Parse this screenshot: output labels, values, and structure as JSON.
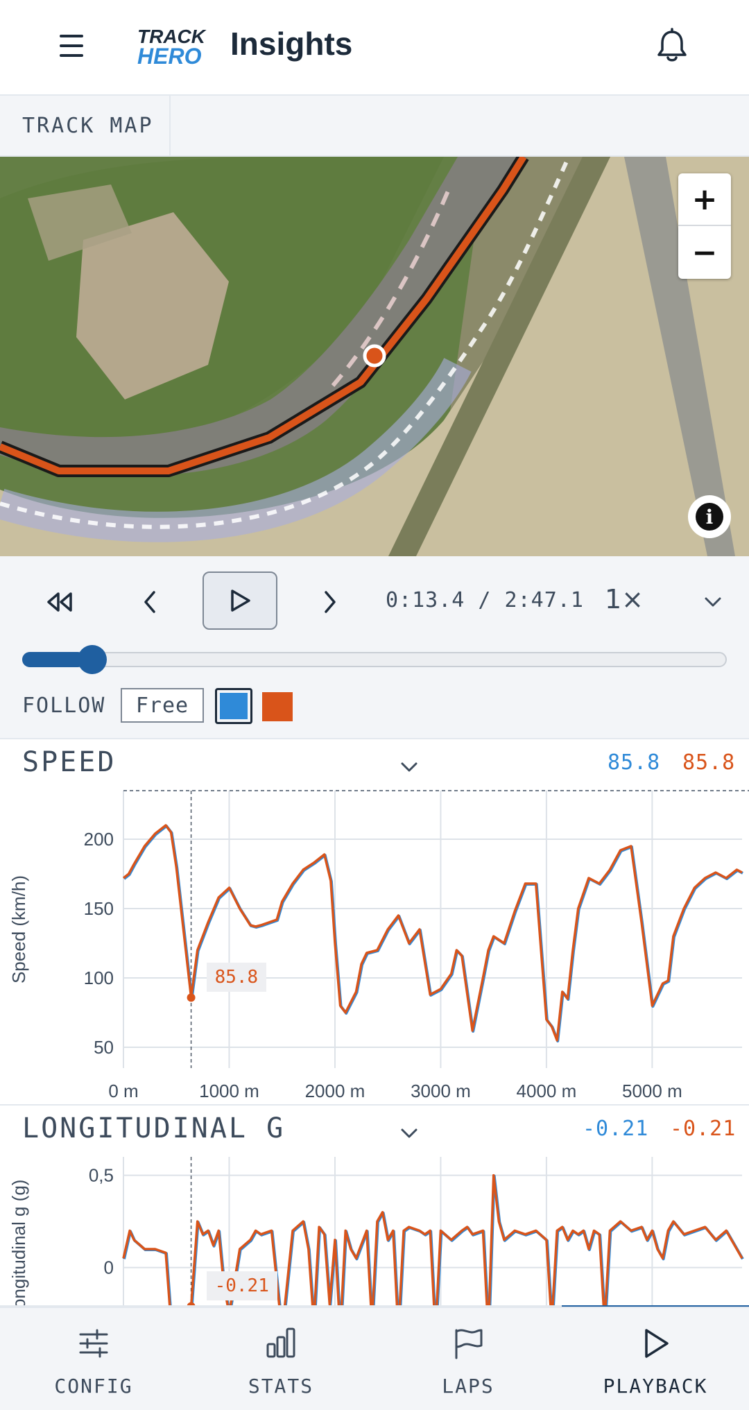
{
  "colors": {
    "accent_blue": "#2f8ad8",
    "accent_orange": "#d9541a",
    "dark_blue": "#1f5fa0",
    "text": "#1c2a3a",
    "muted_text": "#3d4b5c",
    "panel_bg": "#f3f5f8"
  },
  "header": {
    "menu_icon": "hamburger-menu-icon",
    "logo_line1": "TRACK",
    "logo_line2": "HERO",
    "title": "Insights",
    "notification_icon": "bell-icon"
  },
  "tabs": [
    {
      "label": "TRACK MAP"
    }
  ],
  "map": {
    "zoom_in": "+",
    "zoom_out": "−",
    "info_icon": "info-icon",
    "info_glyph": "i"
  },
  "playback": {
    "rewind_icon": "rewind-icon",
    "prev_icon": "chevron-left-icon",
    "play_icon": "play-icon",
    "next_icon": "chevron-right-icon",
    "time": "0:13.4 / 2:47.1",
    "speed": "1×",
    "speed_menu_icon": "chevron-down-icon",
    "progress": 0.08,
    "follow_label": "FOLLOW",
    "follow_free": "Free"
  },
  "speed_panel": {
    "title": "SPEED",
    "value_a": "85.8",
    "value_b": "85.8",
    "marker_label": "85.8"
  },
  "long_g_panel": {
    "title": "LONGITUDINAL G",
    "value_a": "-0.21",
    "value_b": "-0.21",
    "marker_label": "-0.21"
  },
  "chart_data": [
    {
      "type": "line",
      "title": "SPEED",
      "xlabel": "",
      "ylabel": "Speed (km/h)",
      "x_ticks": [
        "0 m",
        "1000 m",
        "2000 m",
        "3000 m",
        "4000 m",
        "5000 m"
      ],
      "y_ticks": [
        "50",
        "100",
        "150",
        "200"
      ],
      "xlim": [
        0,
        5850
      ],
      "ylim": [
        35,
        235
      ],
      "cursor_x": 640,
      "cursor_value": 85.8,
      "x": [
        0,
        50,
        100,
        200,
        300,
        400,
        450,
        500,
        640,
        700,
        800,
        900,
        1000,
        1100,
        1200,
        1250,
        1300,
        1450,
        1500,
        1600,
        1700,
        1800,
        1900,
        1960,
        2000,
        2050,
        2100,
        2200,
        2250,
        2300,
        2400,
        2500,
        2600,
        2700,
        2800,
        2900,
        3000,
        3100,
        3150,
        3200,
        3300,
        3400,
        3450,
        3500,
        3600,
        3700,
        3800,
        3900,
        4000,
        4050,
        4100,
        4150,
        4200,
        4250,
        4300,
        4400,
        4500,
        4600,
        4700,
        4800,
        4900,
        5000,
        5100,
        5150,
        5200,
        5300,
        5400,
        5500,
        5600,
        5700,
        5800,
        5850
      ],
      "series": [
        {
          "values": [
            172,
            175,
            182,
            195,
            204,
            210,
            205,
            180,
            86,
            120,
            140,
            158,
            165,
            150,
            138,
            137,
            138,
            142,
            155,
            168,
            178,
            183,
            189,
            170,
            125,
            80,
            75,
            90,
            110,
            118,
            120,
            135,
            145,
            125,
            135,
            88,
            92,
            103,
            120,
            116,
            62,
            100,
            120,
            130,
            125,
            148,
            168,
            168,
            70,
            65,
            55,
            90,
            85,
            120,
            150,
            172,
            168,
            178,
            192,
            195,
            140,
            80,
            96,
            98,
            130,
            150,
            165,
            172,
            176,
            172,
            178,
            176
          ]
        }
      ]
    },
    {
      "type": "line",
      "title": "LONGITUDINAL G",
      "xlabel": "",
      "ylabel": "Longitudinal g (g)",
      "x_ticks": [],
      "y_ticks": [
        "0,5",
        "0"
      ],
      "xlim": [
        0,
        5850
      ],
      "ylim": [
        -0.4,
        0.6
      ],
      "cursor_x": 640,
      "cursor_value": -0.21,
      "x": [
        0,
        60,
        100,
        200,
        300,
        400,
        450,
        500,
        640,
        700,
        750,
        800,
        850,
        900,
        950,
        1000,
        1100,
        1200,
        1250,
        1300,
        1400,
        1500,
        1600,
        1700,
        1750,
        1800,
        1850,
        1900,
        1950,
        2000,
        2050,
        2100,
        2150,
        2200,
        2300,
        2350,
        2400,
        2450,
        2500,
        2550,
        2600,
        2650,
        2700,
        2800,
        2850,
        2900,
        2950,
        3000,
        3100,
        3200,
        3250,
        3300,
        3400,
        3450,
        3500,
        3550,
        3600,
        3700,
        3800,
        3900,
        4000,
        4050,
        4100,
        4150,
        4200,
        4250,
        4300,
        4350,
        4400,
        4450,
        4500,
        4550,
        4600,
        4700,
        4800,
        4900,
        4950,
        5000,
        5050,
        5100,
        5150,
        5200,
        5300,
        5400,
        5500,
        5600,
        5700,
        5800,
        5850
      ],
      "series": [
        {
          "values": [
            0.05,
            0.2,
            0.15,
            0.1,
            0.1,
            0.08,
            -0.3,
            -0.4,
            -0.21,
            0.25,
            0.18,
            0.2,
            0.12,
            0.2,
            -0.1,
            -0.25,
            0.1,
            0.15,
            0.2,
            0.18,
            0.2,
            -0.35,
            0.2,
            0.25,
            0.1,
            -0.3,
            0.22,
            0.18,
            -0.2,
            0.15,
            -0.35,
            0.2,
            0.1,
            0.05,
            0.2,
            -0.3,
            0.25,
            0.3,
            0.15,
            0.2,
            -0.35,
            0.2,
            0.22,
            0.2,
            0.18,
            0.2,
            -0.35,
            0.2,
            0.15,
            0.2,
            0.22,
            0.18,
            0.2,
            -0.35,
            0.5,
            0.25,
            0.15,
            0.2,
            0.18,
            0.2,
            0.15,
            -0.3,
            0.2,
            0.22,
            0.15,
            0.2,
            0.18,
            0.2,
            0.1,
            0.2,
            0.18,
            -0.3,
            0.2,
            0.25,
            0.2,
            0.22,
            0.15,
            0.2,
            0.1,
            0.05,
            0.2,
            0.25,
            0.18,
            0.2,
            0.22,
            0.15,
            0.2,
            0.1,
            0.05
          ]
        }
      ]
    }
  ],
  "bottom_nav": [
    {
      "label": "CONFIG",
      "icon": "sliders-icon"
    },
    {
      "label": "STATS",
      "icon": "bar-chart-icon"
    },
    {
      "label": "LAPS",
      "icon": "flag-icon"
    },
    {
      "label": "PLAYBACK",
      "icon": "play-icon"
    }
  ]
}
